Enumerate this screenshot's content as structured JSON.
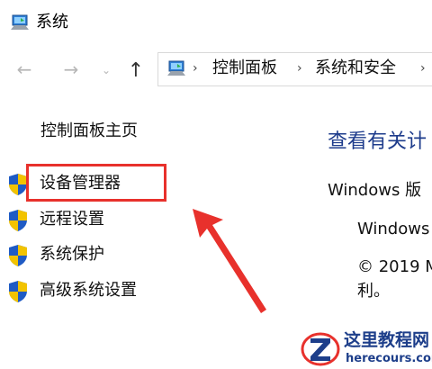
{
  "window": {
    "title": "系统",
    "icon": "system-computer-icon"
  },
  "nav": {
    "back_glyph": "←",
    "forward_glyph": "→",
    "recent_glyph": "⌄",
    "up_glyph": "↑",
    "breadcrumbs": [
      "控制面板",
      "系统和安全"
    ],
    "separator_glyph": "›"
  },
  "sidebar": {
    "home_label": "控制面板主页",
    "items": [
      {
        "label": "设备管理器",
        "icon": "uac-shield-icon"
      },
      {
        "label": "远程设置",
        "icon": "uac-shield-icon"
      },
      {
        "label": "系统保护",
        "icon": "uac-shield-icon"
      },
      {
        "label": "高级系统设置",
        "icon": "uac-shield-icon"
      }
    ]
  },
  "content": {
    "title": "查看有关计",
    "edition_label": "Windows 版",
    "windows_name": "Windows",
    "copyright": "© 2019 M",
    "rights": "利。"
  },
  "annotation": {
    "highlight_color": "#e8312c",
    "highlighted_item": "设备管理器"
  },
  "watermark": {
    "title": "这里教程网",
    "url": "herecours.com"
  },
  "colors": {
    "link_blue": "#1e3c8c",
    "shield_blue": "#1f5bc4",
    "shield_yellow": "#f2c300",
    "watermark_blue": "#1d3e8a"
  }
}
